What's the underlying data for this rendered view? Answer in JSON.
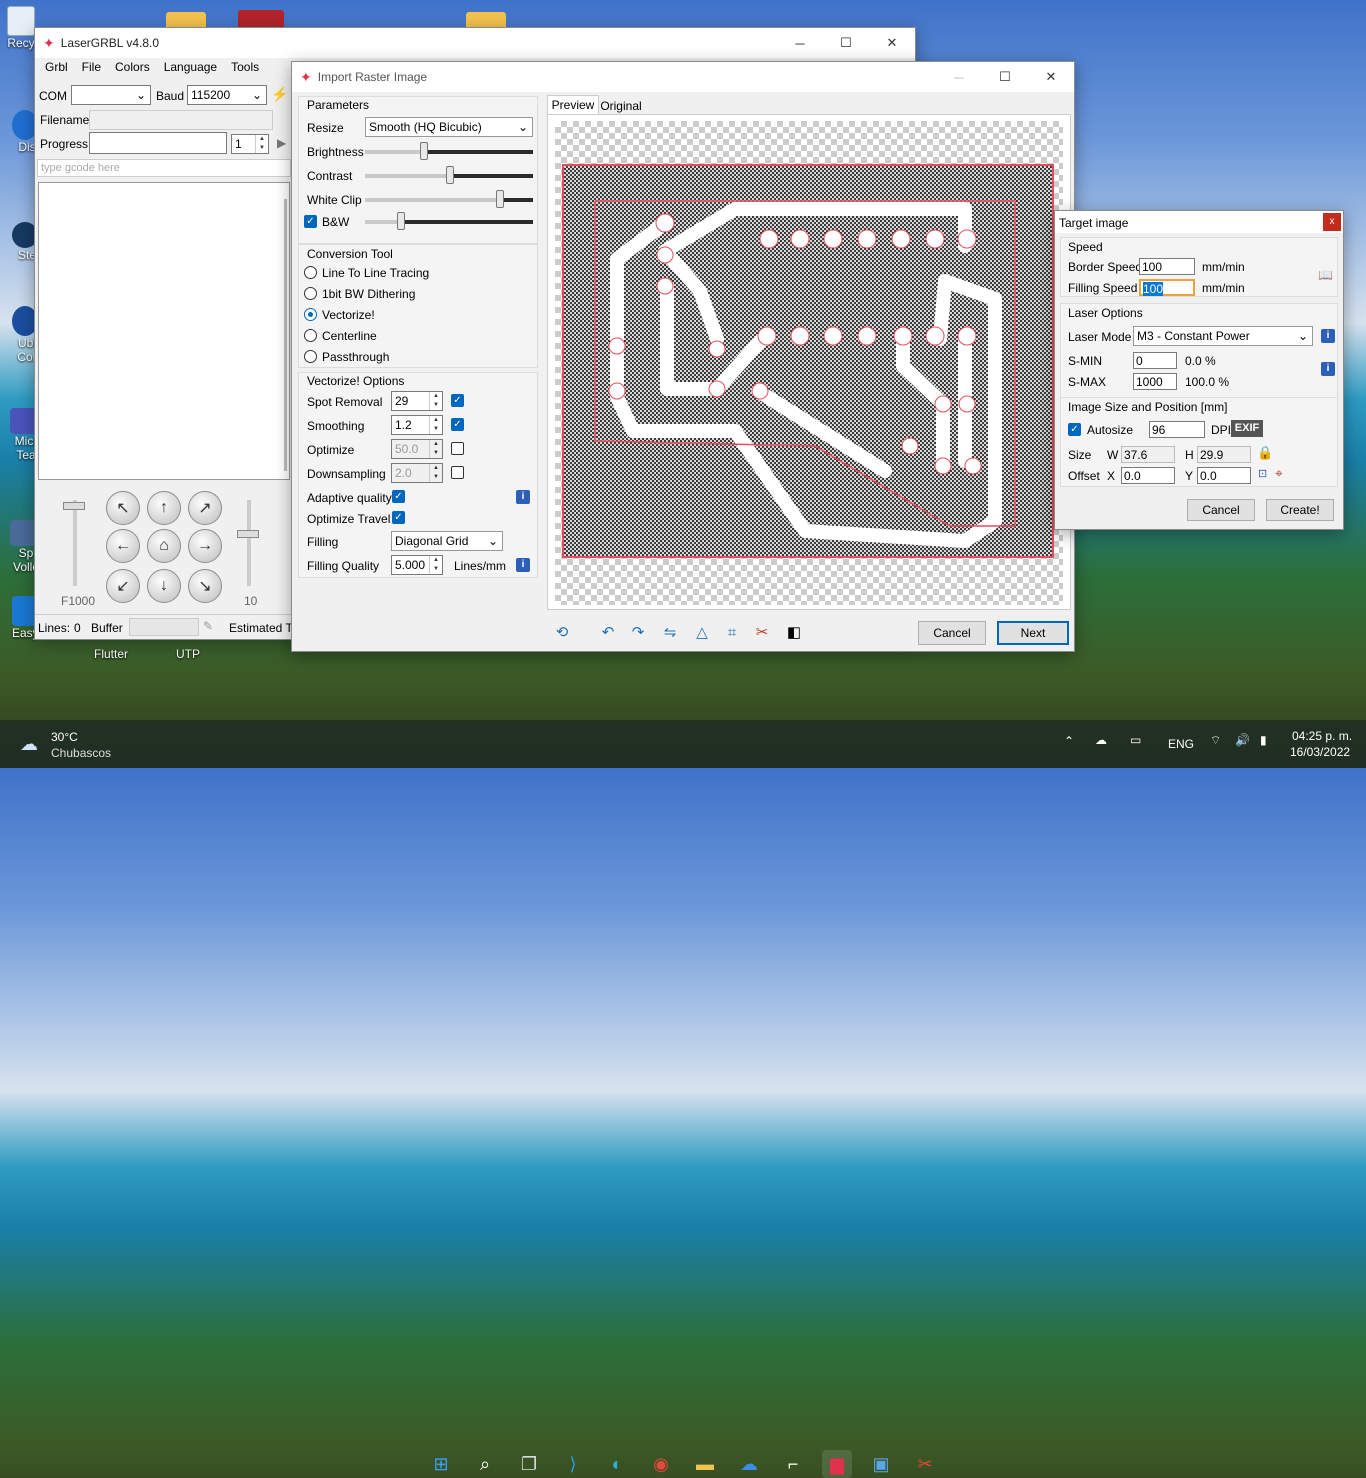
{
  "desktop": {
    "icons": [
      {
        "label": "Recy"
      },
      {
        "label": "Dis"
      },
      {
        "label": "Ste"
      },
      {
        "label": "Ubi"
      },
      {
        "label": "Cor"
      },
      {
        "label": "Micr"
      },
      {
        "label": "Tea"
      },
      {
        "label": "Sp"
      },
      {
        "label": "Volle"
      },
      {
        "label": "EasyEDA"
      },
      {
        "label": "Flutter"
      },
      {
        "label": "UTP"
      }
    ]
  },
  "laser": {
    "title": "LaserGRBL v4.8.0",
    "menu": [
      "Grbl",
      "File",
      "Colors",
      "Language",
      "Tools"
    ],
    "com_label": "COM",
    "com_value": "",
    "baud_label": "Baud",
    "baud_value": "115200",
    "filename_label": "Filename",
    "progress_label": "Progress",
    "progress_value": "1",
    "gcode_placeholder": "type gcode here",
    "speed_label": "F1000",
    "step_label": "10",
    "lines_label": "Lines:",
    "lines_value": "0",
    "buffer_label": "Buffer",
    "estimated_label": "Estimated Ti"
  },
  "import": {
    "title": "Import Raster Image",
    "params_title": "Parameters",
    "resize_label": "Resize",
    "resize_value": "Smooth (HQ Bicubic)",
    "brightness_label": "Brightness",
    "contrast_label": "Contrast",
    "whiteclip_label": "White Clip",
    "bw_label": "B&W",
    "conv_title": "Conversion Tool",
    "conv_options": [
      "Line To Line Tracing",
      "1bit BW Dithering",
      "Vectorize!",
      "Centerline",
      "Passthrough"
    ],
    "vec_title": "Vectorize! Options",
    "spot_label": "Spot Removal",
    "spot_value": "29",
    "smoothing_label": "Smoothing",
    "smoothing_value": "1.2",
    "optimize_label": "Optimize",
    "optimize_value": "50.0",
    "downsampling_label": "Downsampling",
    "downsampling_value": "2.0",
    "adaptive_label": "Adaptive quality",
    "optimize_travel_label": "Optimize Travel",
    "filling_label": "Filling",
    "filling_value": "Diagonal Grid",
    "filling_quality_label": "Filling Quality",
    "filling_quality_value": "5.000",
    "filling_quality_unit": "Lines/mm",
    "tab_preview": "Preview",
    "tab_original": "Original",
    "cancel": "Cancel",
    "next": "Next"
  },
  "target": {
    "title": "Target image",
    "speed_title": "Speed",
    "border_speed_label": "Border Speed",
    "border_speed_value": "100",
    "filling_speed_label": "Filling Speed",
    "filling_speed_value": "100",
    "unit1": "mm/min",
    "unit2": "mm/min",
    "laser_title": "Laser Options",
    "laser_mode_label": "Laser Mode",
    "laser_mode_value": "M3 - Constant Power",
    "smin_label": "S-MIN",
    "smin_value": "0",
    "smin_pct": "0.0 %",
    "smax_label": "S-MAX",
    "smax_value": "1000",
    "smax_pct": "100.0 %",
    "size_title": "Image Size and Position [mm]",
    "autosize_label": "Autosize",
    "dpi_value": "96",
    "dpi_label": "DPI",
    "exif": "EXIF",
    "size_label": "Size",
    "w_label": "W",
    "w_value": "37.6",
    "h_label": "H",
    "h_value": "29.9",
    "offset_label": "Offset",
    "x_label": "X",
    "x_value": "0.0",
    "y_label": "Y",
    "y_value": "0.0",
    "cancel": "Cancel",
    "create": "Create!"
  },
  "taskbar": {
    "temp": "30°C",
    "weather": "Chubascos",
    "lang": "ENG",
    "time": "04:25 p. m.",
    "date": "16/03/2022"
  }
}
